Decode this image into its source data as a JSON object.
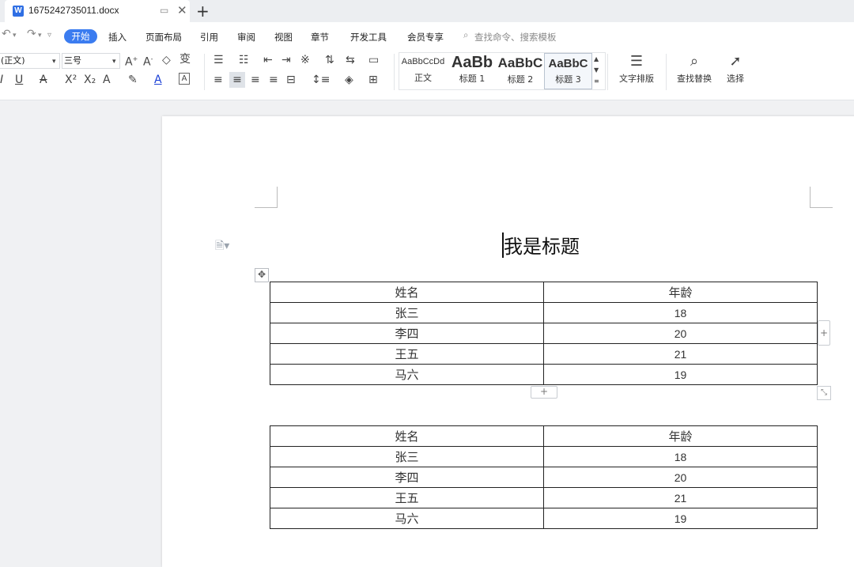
{
  "tab": {
    "filename": "1675242735011.docx",
    "app_icon": "W"
  },
  "menu": {
    "items": [
      "开始",
      "插入",
      "页面布局",
      "引用",
      "审阅",
      "视图",
      "章节",
      "开发工具",
      "会员专享"
    ],
    "search_placeholder": "查找命令、搜索模板"
  },
  "toolbar": {
    "font_name": "(正文)",
    "font_size": "三号",
    "styles": [
      {
        "sample": "AaBbCcDd",
        "label": "正文"
      },
      {
        "sample": "AaBb",
        "label": "标题 1"
      },
      {
        "sample": "AaBbC",
        "label": "标题 2"
      },
      {
        "sample": "AaBbC",
        "label": "标题 3"
      }
    ],
    "text_layout": "文字排版",
    "find_replace": "查找替换",
    "select": "选择"
  },
  "document": {
    "title": "我是标题",
    "tables": [
      {
        "headers": [
          "姓名",
          "年龄"
        ],
        "rows": [
          [
            "张三",
            "18"
          ],
          [
            "李四",
            "20"
          ],
          [
            "王五",
            "21"
          ],
          [
            "马六",
            "19"
          ]
        ]
      },
      {
        "headers": [
          "姓名",
          "年龄"
        ],
        "rows": [
          [
            "张三",
            "18"
          ],
          [
            "李四",
            "20"
          ],
          [
            "王五",
            "21"
          ],
          [
            "马六",
            "19"
          ]
        ]
      }
    ]
  },
  "colors": {
    "accent": "#3b7cf0",
    "word_icon": "#2f6fe4"
  }
}
